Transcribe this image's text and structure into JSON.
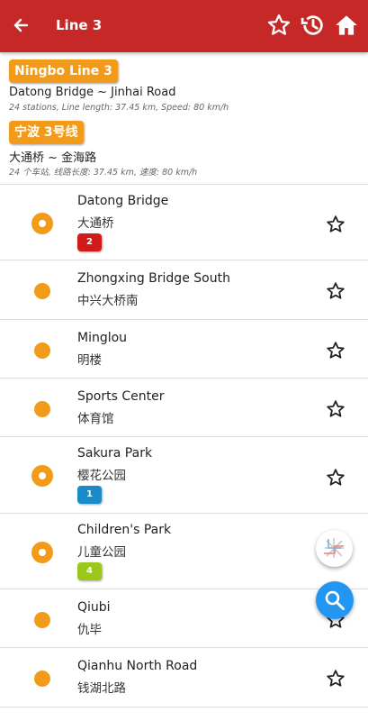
{
  "appbar": {
    "title": "Line 3",
    "back_icon": "arrow-left-icon",
    "actions": [
      "star-outline-icon",
      "history-icon",
      "home-icon"
    ]
  },
  "line": {
    "badge_en": "Ningbo Line 3",
    "route_en": "Datong Bridge ~ Jinhai Road",
    "meta_en": "24 stations, Line length: 37.45 km, Speed: 80 km/h",
    "badge_zh": "宁波 3号线",
    "route_zh": "大通桥 ~ 金海路",
    "meta_zh": "24 个车站, 线路长度: 37.45 km, 速度: 80 km/h",
    "color": "#f29b1a"
  },
  "stations": [
    {
      "en": "Datong Bridge",
      "zh": "大通桥",
      "transfer": {
        "label": "2",
        "color": "#d31a1a"
      }
    },
    {
      "en": "Zhongxing Bridge South",
      "zh": "中兴大桥南"
    },
    {
      "en": "Minglou",
      "zh": "明楼"
    },
    {
      "en": "Sports Center",
      "zh": "体育馆"
    },
    {
      "en": "Sakura Park",
      "zh": "樱花公园",
      "transfer": {
        "label": "1",
        "color": "#1a8ac8"
      }
    },
    {
      "en": "Children's Park",
      "zh": "儿童公园",
      "transfer": {
        "label": "4",
        "color": "#9ac71a"
      }
    },
    {
      "en": "Qiubi",
      "zh": "仇毕"
    },
    {
      "en": "Qianhu North Road",
      "zh": "钱湖北路"
    }
  ],
  "fabs": {
    "map": "metro-map-icon",
    "search": "search-icon"
  }
}
